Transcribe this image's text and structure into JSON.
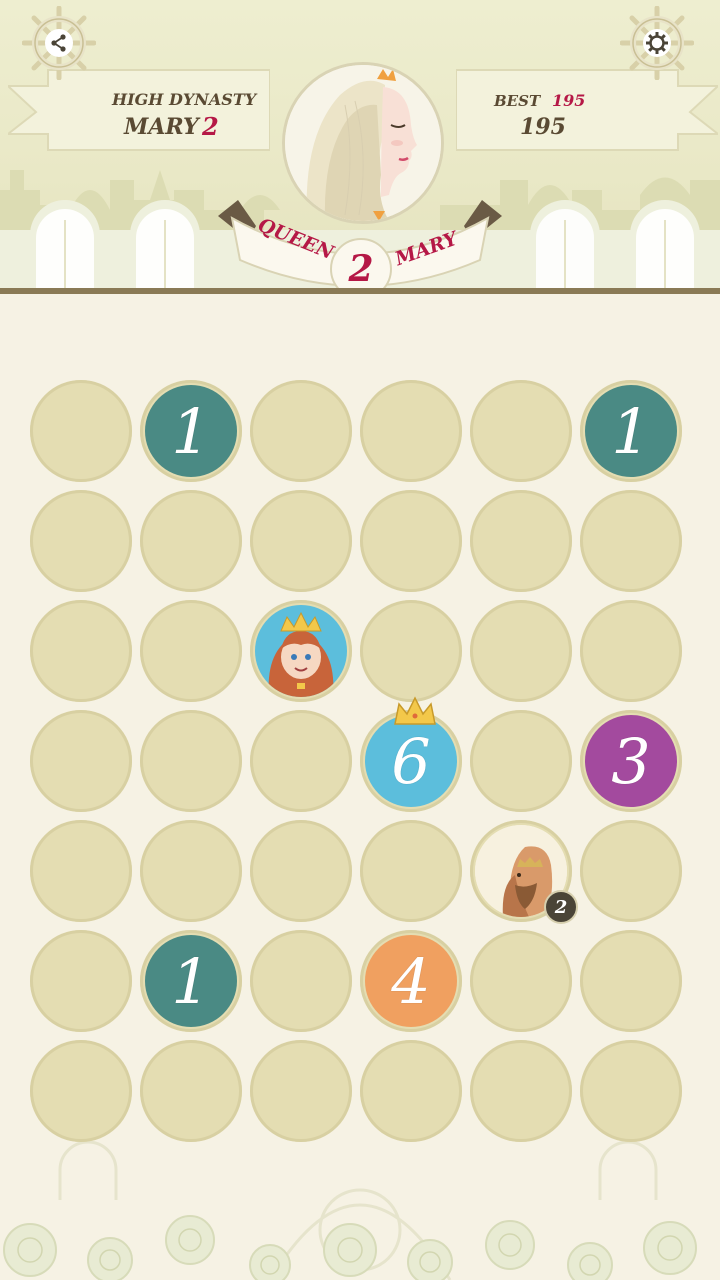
{
  "header": {
    "dynasty_label": "High Dynasty",
    "dynasty_name": "Mary",
    "dynasty_number": "2",
    "best_label": "Best",
    "best_value": "195",
    "score": "195",
    "ribbon_left": "Queen",
    "ribbon_number": "2",
    "ribbon_right": "Mary",
    "share_icon": "share-icon",
    "settings_icon": "gear-icon"
  },
  "colors": {
    "accent_red": "#b51846",
    "teal": "#4a8a84",
    "sky": "#5cbedc",
    "purple": "#a34a9e",
    "orange": "#f0a060",
    "cell": "#e4ddb2"
  },
  "board": {
    "rows": [
      [
        {
          "type": "empty"
        },
        {
          "type": "number",
          "value": "1",
          "color": "teal"
        },
        {
          "type": "empty"
        },
        {
          "type": "empty"
        },
        {
          "type": "empty"
        },
        {
          "type": "number",
          "value": "1",
          "color": "teal"
        }
      ],
      [
        {
          "type": "empty"
        },
        {
          "type": "empty"
        },
        {
          "type": "empty"
        },
        {
          "type": "empty"
        },
        {
          "type": "empty"
        },
        {
          "type": "empty"
        }
      ],
      [
        {
          "type": "empty"
        },
        {
          "type": "empty"
        },
        {
          "type": "queen-portrait"
        },
        {
          "type": "empty"
        },
        {
          "type": "empty"
        },
        {
          "type": "empty"
        }
      ],
      [
        {
          "type": "empty"
        },
        {
          "type": "empty"
        },
        {
          "type": "empty"
        },
        {
          "type": "number",
          "value": "6",
          "color": "sky",
          "crowned": true
        },
        {
          "type": "empty"
        },
        {
          "type": "number",
          "value": "3",
          "color": "purple"
        }
      ],
      [
        {
          "type": "empty"
        },
        {
          "type": "empty"
        },
        {
          "type": "empty"
        },
        {
          "type": "empty"
        },
        {
          "type": "king-portrait",
          "badge": "2"
        },
        {
          "type": "empty"
        }
      ],
      [
        {
          "type": "empty"
        },
        {
          "type": "number",
          "value": "1",
          "color": "teal"
        },
        {
          "type": "empty"
        },
        {
          "type": "number",
          "value": "4",
          "color": "orange"
        },
        {
          "type": "empty"
        },
        {
          "type": "empty"
        }
      ],
      [
        {
          "type": "empty"
        },
        {
          "type": "empty"
        },
        {
          "type": "empty"
        },
        {
          "type": "empty"
        },
        {
          "type": "empty"
        },
        {
          "type": "empty"
        }
      ]
    ]
  }
}
